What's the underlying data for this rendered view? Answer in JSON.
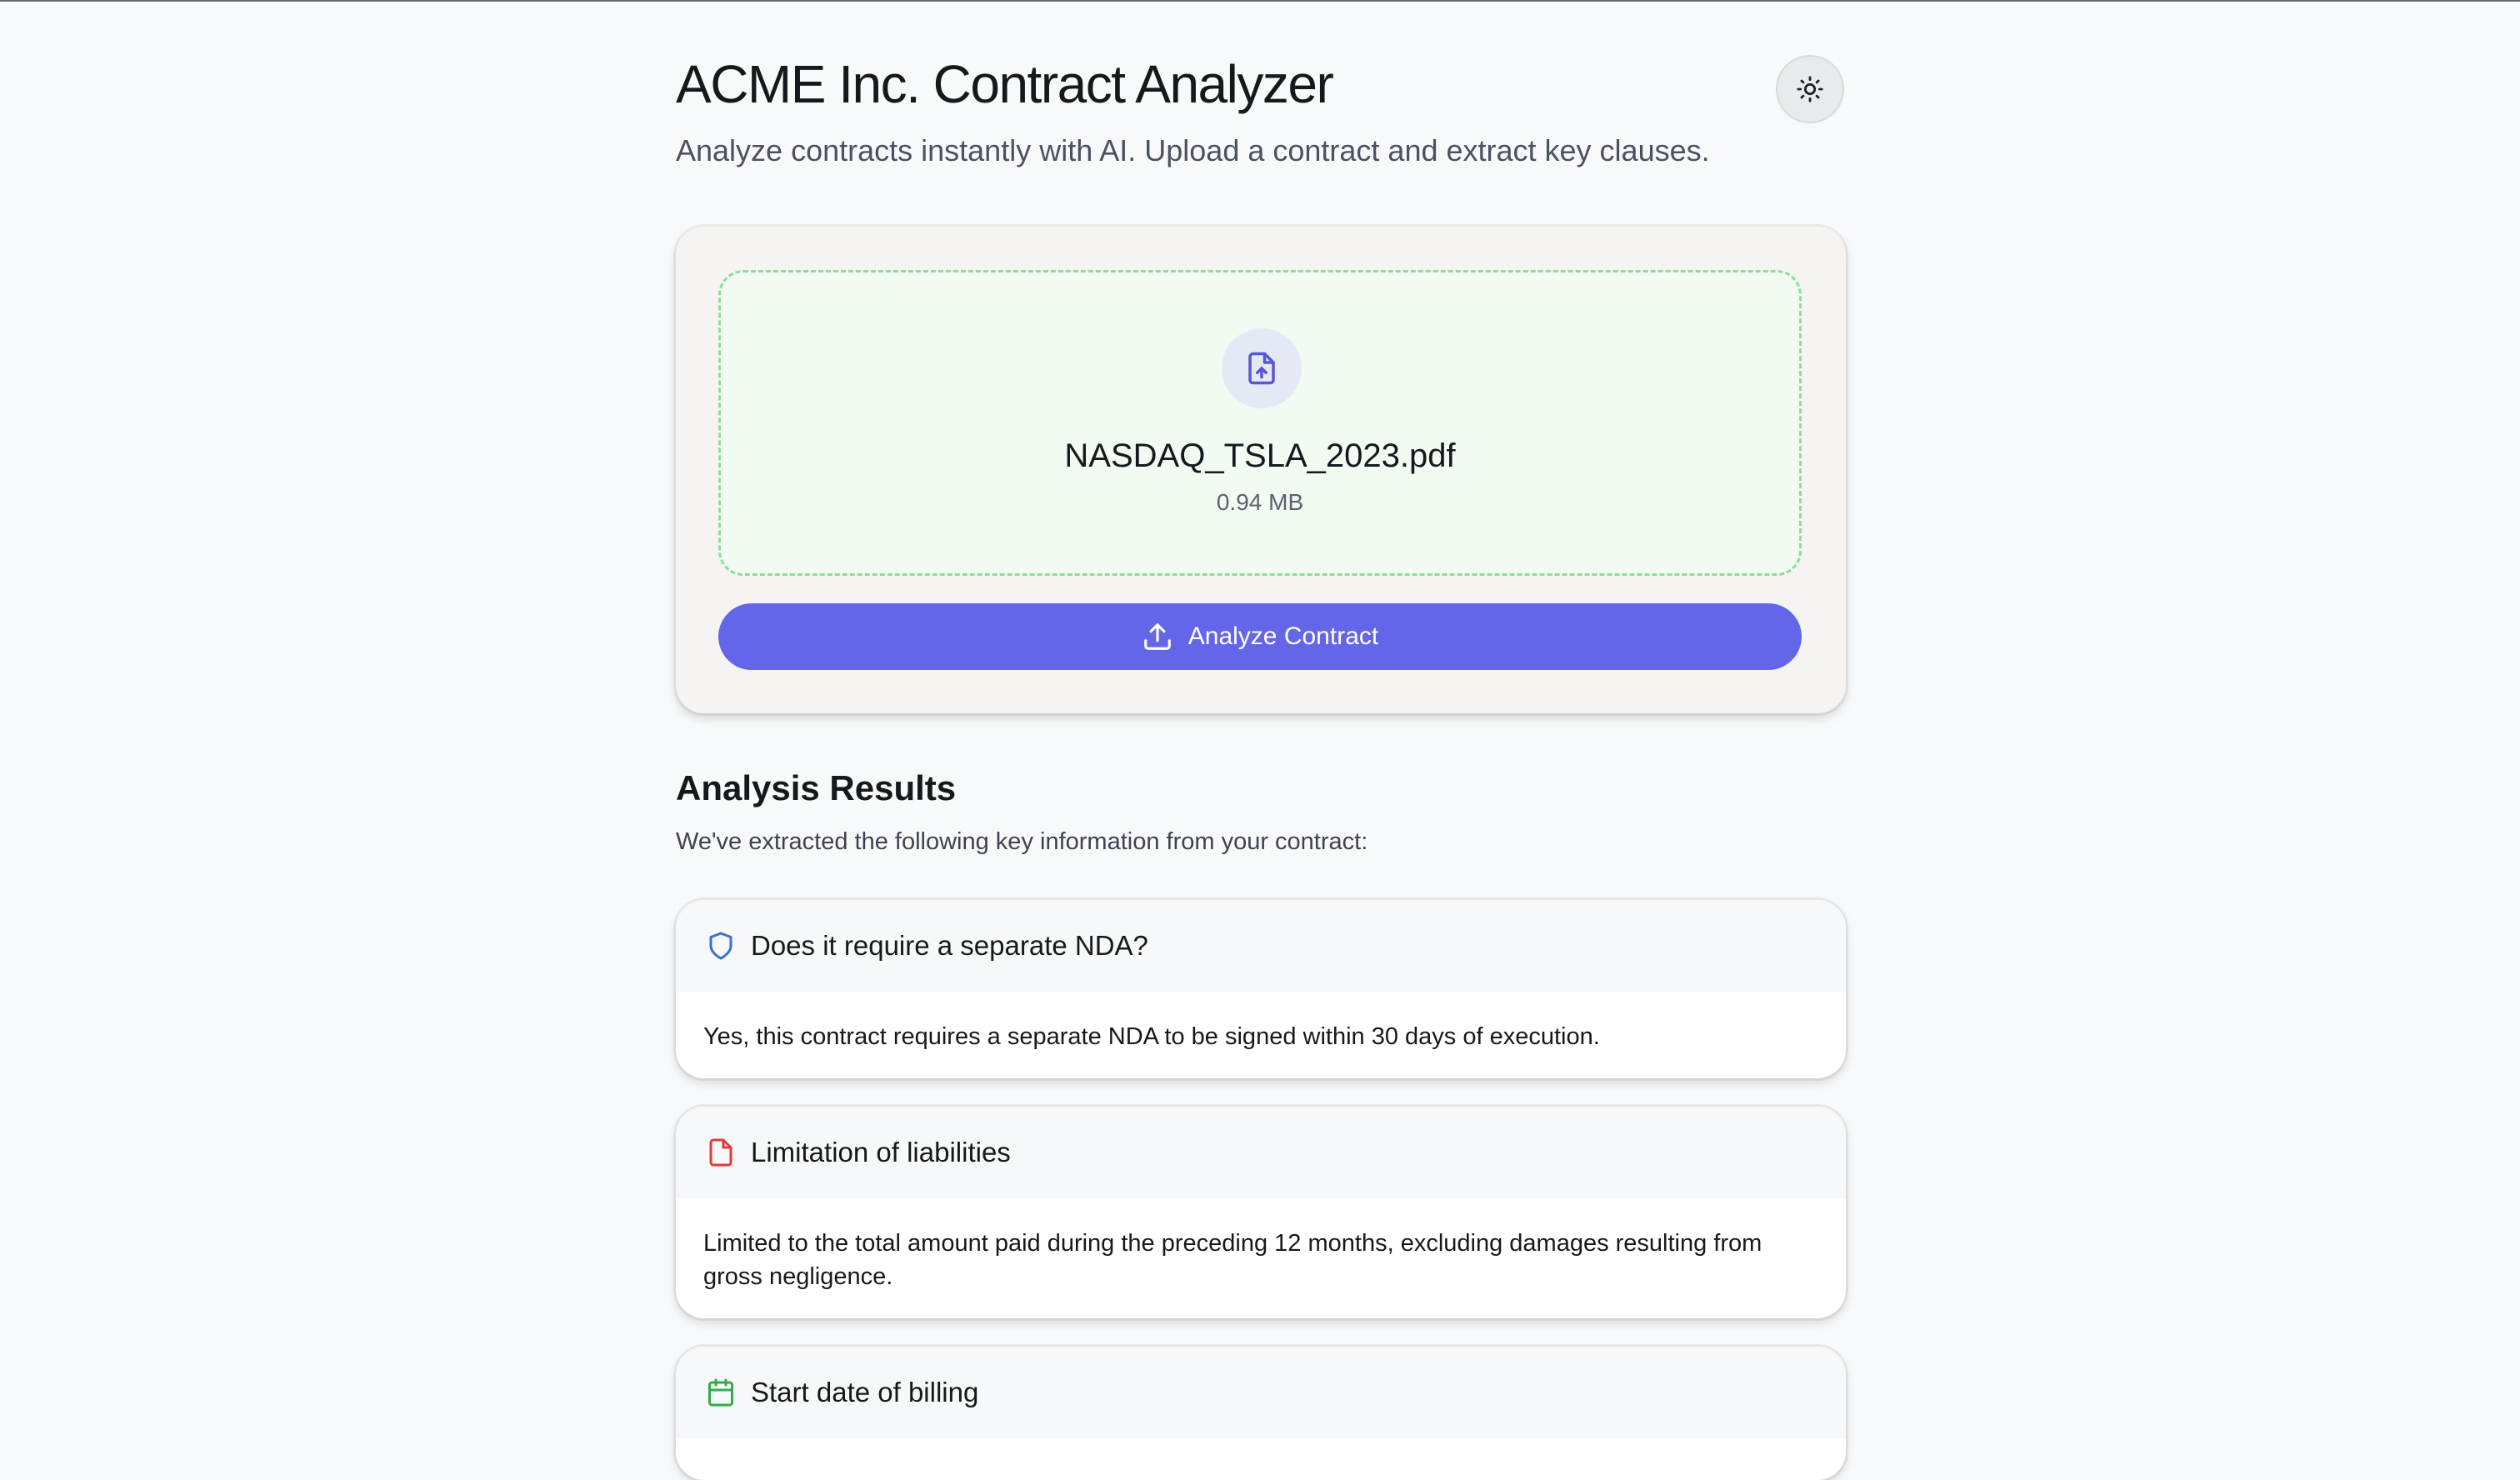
{
  "header": {
    "title": "ACME Inc. Contract Analyzer",
    "subtitle": "Analyze contracts instantly with AI. Upload a contract and extract key clauses.",
    "theme_toggle_icon": "sun-icon"
  },
  "upload": {
    "file_icon": "file-upload-icon",
    "file_name": "NASDAQ_TSLA_2023.pdf",
    "file_size": "0.94 MB",
    "analyze_button_label": "Analyze Contract",
    "analyze_button_icon": "upload-icon"
  },
  "results": {
    "title": "Analysis Results",
    "subtitle": "We've extracted the following key information from your contract:",
    "items": [
      {
        "icon": "shield-icon",
        "icon_color": "#3b6fd8",
        "question": "Does it require a separate NDA?",
        "answer": "Yes, this contract requires a separate NDA to be signed within 30 days of execution."
      },
      {
        "icon": "document-icon",
        "icon_color": "#e03a3a",
        "question": "Limitation of liabilities",
        "answer": "Limited to the total amount paid during the preceding 12 months, excluding damages resulting from gross negligence."
      },
      {
        "icon": "calendar-icon",
        "icon_color": "#2fae4a",
        "question": "Start date of billing",
        "answer": ""
      }
    ]
  },
  "colors": {
    "accent": "#6466e9",
    "dropzone_border": "#8fdc9c",
    "dropzone_bg": "#f1fbf1"
  }
}
